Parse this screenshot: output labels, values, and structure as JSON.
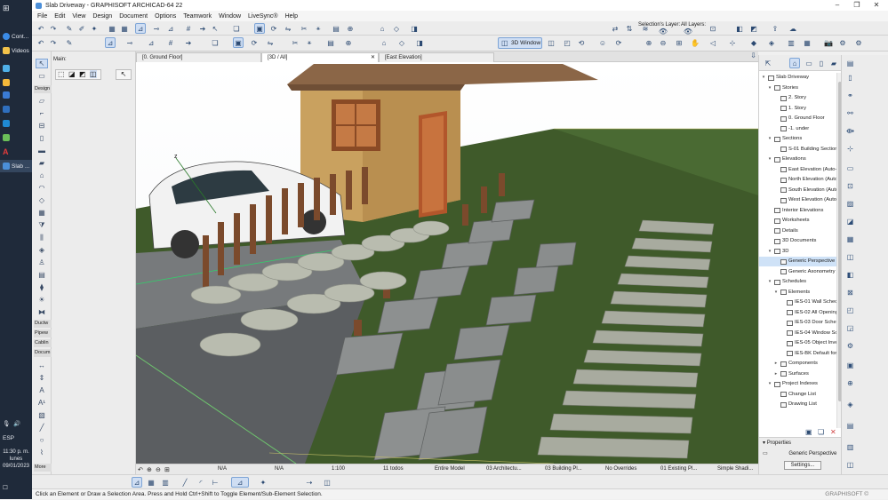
{
  "taskbar": {
    "items": [
      {
        "label": "Cont...",
        "icon": "chrome-icon",
        "color": "#3b8be6"
      },
      {
        "label": "Videos",
        "icon": "folder-icon",
        "color": "#f3c34a"
      },
      {
        "label": "Slab ...",
        "icon": "archicad-icon",
        "color": "#4b8fd9"
      }
    ],
    "language": "ESP",
    "time": "11:30 p. m.",
    "day": "lunes",
    "date": "09/01/2023"
  },
  "window": {
    "title": "Slab Driveway - GRAPHISOFT ARCHICAD-64 22"
  },
  "menu": [
    "File",
    "Edit",
    "View",
    "Design",
    "Document",
    "Options",
    "Teamwork",
    "Window",
    "LiveSync®",
    "Help"
  ],
  "toolbar": {
    "selection_layer_label": "Selection's Layer:",
    "all_layers_label": "All Layers:",
    "window_3d_label": "3D Window"
  },
  "toolbox": {
    "main_label": "Main:",
    "sections": [
      "Design",
      "Ductw",
      "Pipew",
      "Cablin",
      "Docum",
      "More"
    ]
  },
  "tabs": [
    {
      "label": "[0. Ground Floor]"
    },
    {
      "label": "[3D / All]"
    },
    {
      "label": "[East Elevation]"
    }
  ],
  "viewbar": {
    "na1": "N/A",
    "na2": "N/A",
    "scale": "1:100",
    "layers": "11 todos",
    "model": "Entire Model",
    "pen": "03 Architectu...",
    "building": "03 Building Pl...",
    "overrides": "No Overrides",
    "existing": "01 Existing Pl...",
    "shading": "Simple Shadi..."
  },
  "navigator": {
    "rows": [
      {
        "label": "Slab Driveway",
        "level": 0,
        "fold": "▾"
      },
      {
        "label": "Stories",
        "level": 1,
        "fold": "▾"
      },
      {
        "label": "2. Story",
        "level": 2,
        "fold": ""
      },
      {
        "label": "1. Story",
        "level": 2,
        "fold": ""
      },
      {
        "label": "0. Ground Floor",
        "level": 2,
        "fold": ""
      },
      {
        "label": "-1. under",
        "level": 2,
        "fold": ""
      },
      {
        "label": "Sections",
        "level": 1,
        "fold": "▾"
      },
      {
        "label": "S-01 Building Section",
        "level": 2,
        "fold": ""
      },
      {
        "label": "Elevations",
        "level": 1,
        "fold": "▾"
      },
      {
        "label": "East Elevation (Auto-rebuild)",
        "level": 2,
        "fold": ""
      },
      {
        "label": "North Elevation (Auto-rebuild)",
        "level": 2,
        "fold": ""
      },
      {
        "label": "South Elevation (Auto-rebuild)",
        "level": 2,
        "fold": ""
      },
      {
        "label": "West Elevation (Auto-rebuild)",
        "level": 2,
        "fold": ""
      },
      {
        "label": "Interior Elevations",
        "level": 1,
        "fold": ""
      },
      {
        "label": "Worksheets",
        "level": 1,
        "fold": ""
      },
      {
        "label": "Details",
        "level": 1,
        "fold": ""
      },
      {
        "label": "3D Documents",
        "level": 1,
        "fold": ""
      },
      {
        "label": "3D",
        "level": 1,
        "fold": "▾"
      },
      {
        "label": "Generic Perspective",
        "level": 2,
        "fold": "",
        "selected": true
      },
      {
        "label": "Generic Axonometry",
        "level": 2,
        "fold": ""
      },
      {
        "label": "Schedules",
        "level": 1,
        "fold": "▾"
      },
      {
        "label": "Elements",
        "level": 2,
        "fold": "▾"
      },
      {
        "label": "IES-01 Wall Schedule",
        "level": 3,
        "fold": ""
      },
      {
        "label": "IES-02 All Openings",
        "level": 3,
        "fold": ""
      },
      {
        "label": "IES-03 Door Schedule",
        "level": 3,
        "fold": ""
      },
      {
        "label": "IES-04 Window Schedule",
        "level": 3,
        "fold": ""
      },
      {
        "label": "IES-05 Object Inventory",
        "level": 3,
        "fold": ""
      },
      {
        "label": "IES-BK Default for...",
        "level": 3,
        "fold": ""
      },
      {
        "label": "Components",
        "level": 2,
        "fold": "▸"
      },
      {
        "label": "Surfaces",
        "level": 2,
        "fold": "▸"
      },
      {
        "label": "Project Indexes",
        "level": 1,
        "fold": "▾"
      },
      {
        "label": "Change List",
        "level": 2,
        "fold": ""
      },
      {
        "label": "Drawing List",
        "level": 2,
        "fold": ""
      }
    ]
  },
  "properties": {
    "title": "Properties",
    "value": "Generic Perspective",
    "settings_label": "Settings..."
  },
  "status": {
    "message": "Click an Element or Draw a Selection Area. Press and Hold Ctrl+Shift to Toggle Element/Sub-Element Selection.",
    "brand": "GRAPHISOFT ©"
  },
  "colors": {
    "accent": "#4a86c8",
    "selected_row": "#cfe2f7",
    "grass": "#3f5a2a",
    "house_wall": "#c9a15f",
    "roof": "#8b6647"
  }
}
